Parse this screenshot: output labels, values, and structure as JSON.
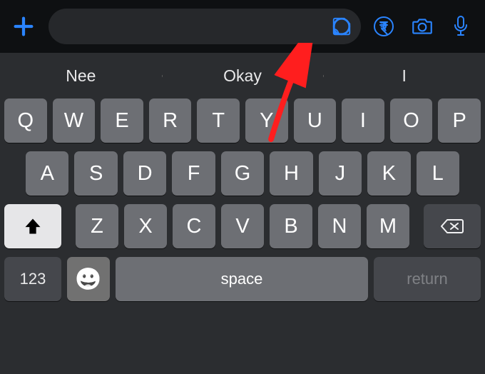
{
  "topbar": {
    "plus_icon": "plus",
    "sticker_icon": "sticker",
    "rupee_icon": "rupee",
    "camera_icon": "camera",
    "mic_icon": "mic"
  },
  "suggestions": [
    "Nee",
    "Okay",
    "I"
  ],
  "keyboard": {
    "row1": [
      "Q",
      "W",
      "E",
      "R",
      "T",
      "Y",
      "U",
      "I",
      "O",
      "P"
    ],
    "row2": [
      "A",
      "S",
      "D",
      "F",
      "G",
      "H",
      "J",
      "K",
      "L"
    ],
    "row3": [
      "Z",
      "X",
      "C",
      "V",
      "B",
      "N",
      "M"
    ],
    "shift_icon": "shift",
    "delete_icon": "delete",
    "numbers_label": "123",
    "emoji_label": "😀",
    "space_label": "space",
    "return_label": "return"
  },
  "annotation": {
    "arrow_target": "sticker-button"
  }
}
